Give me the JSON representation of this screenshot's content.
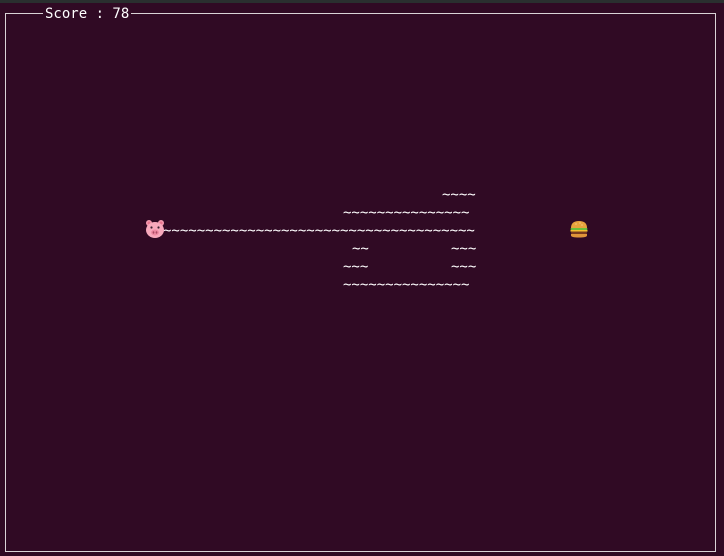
{
  "score": {
    "label": "Score : 78"
  },
  "snake": {
    "head_icon": "pig-face-icon",
    "rows": [
      "~~~~",
      "~~~~~~~~~~~~~~~",
      "~~~~~~~~~~~~~~~~~~~~~~~~~~~~~~~~~~~~~",
      "~~",
      "~~~",
      "~~~",
      "~~~",
      "~~~~~~~~~~~~~~~"
    ]
  },
  "food": {
    "icon": "hamburger-icon"
  },
  "colors": {
    "background": "#300a24",
    "border": "#d9d2d6",
    "text": "#ffffff"
  }
}
